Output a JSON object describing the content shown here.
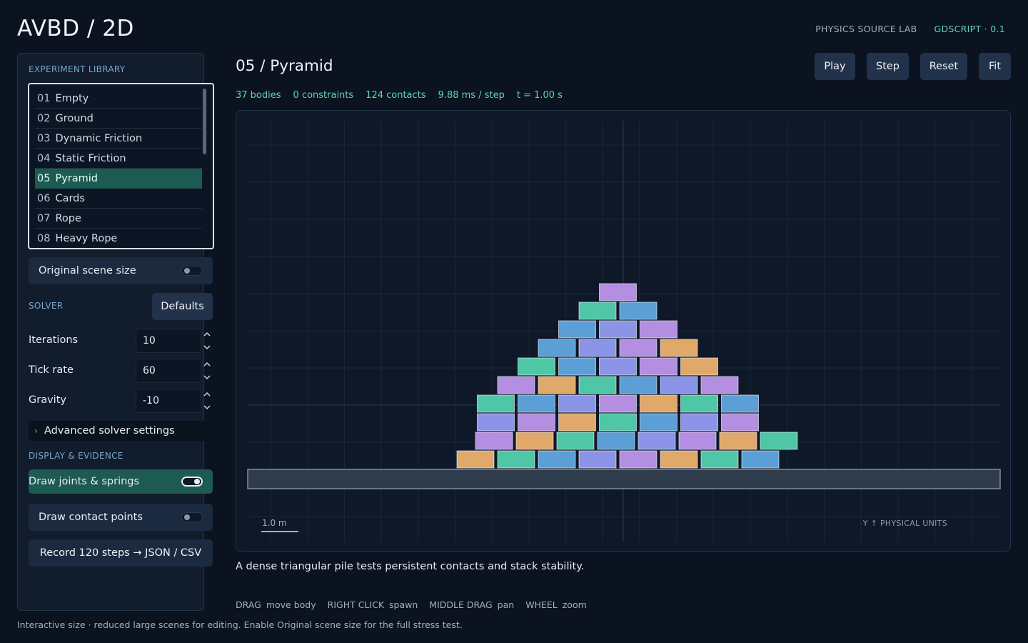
{
  "header": {
    "app_title": "AVBD / 2D",
    "brand_lab": "PHYSICS SOURCE LAB",
    "brand_version": "GDSCRIPT · 0.1"
  },
  "sidebar": {
    "library_label": "EXPERIMENT LIBRARY",
    "experiments": [
      {
        "num": "01",
        "name": "Empty"
      },
      {
        "num": "02",
        "name": "Ground"
      },
      {
        "num": "03",
        "name": "Dynamic Friction"
      },
      {
        "num": "04",
        "name": "Static Friction"
      },
      {
        "num": "05",
        "name": "Pyramid"
      },
      {
        "num": "06",
        "name": "Cards"
      },
      {
        "num": "07",
        "name": "Rope"
      },
      {
        "num": "08",
        "name": "Heavy Rope"
      }
    ],
    "selected_index": 4,
    "original_size_label": "Original scene size",
    "original_size_on": false,
    "solver_label": "SOLVER",
    "defaults_label": "Defaults",
    "iterations_label": "Iterations",
    "iterations_value": "10",
    "tick_rate_label": "Tick rate",
    "tick_rate_value": "60",
    "gravity_label": "Gravity",
    "gravity_value": "-10",
    "advanced_label": "Advanced solver settings",
    "display_label": "DISPLAY & EVIDENCE",
    "draw_joints_label": "Draw joints & springs",
    "draw_joints_on": true,
    "draw_contacts_label": "Draw contact points",
    "draw_contacts_on": false,
    "record_label": "Record 120 steps → JSON / CSV"
  },
  "main": {
    "scene_title": "05 / Pyramid",
    "buttons": {
      "play": "Play",
      "step": "Step",
      "reset": "Reset",
      "fit": "Fit"
    },
    "stats": {
      "bodies": "37 bodies",
      "constraints": "0 constraints",
      "contacts": "124 contacts",
      "ms_per_step": "9.88 ms / step",
      "time": "t = 1.00 s"
    },
    "scale_label": "1.0 m",
    "units_label": "Y ↑   PHYSICAL UNITS",
    "description": "A dense triangular pile tests persistent contacts and stack stability.",
    "hints": [
      {
        "key": "DRAG",
        "action": "move body"
      },
      {
        "key": "RIGHT CLICK",
        "action": "spawn"
      },
      {
        "key": "MIDDLE DRAG",
        "action": "pan"
      },
      {
        "key": "WHEEL",
        "action": "zoom"
      }
    ]
  },
  "footnote": "Interactive size · reduced large scenes for editing. Enable Original scene size for the full stress test.",
  "colors": {
    "accent": "#5fd6b4",
    "selected": "#1d5a52",
    "block_palette": [
      "#e0a96a",
      "#4fc7a6",
      "#5b9fd6",
      "#8b94e6",
      "#b48ee0"
    ]
  },
  "pyramid_rows": [
    8,
    8,
    7,
    7,
    6,
    5,
    4,
    3,
    2,
    1
  ]
}
